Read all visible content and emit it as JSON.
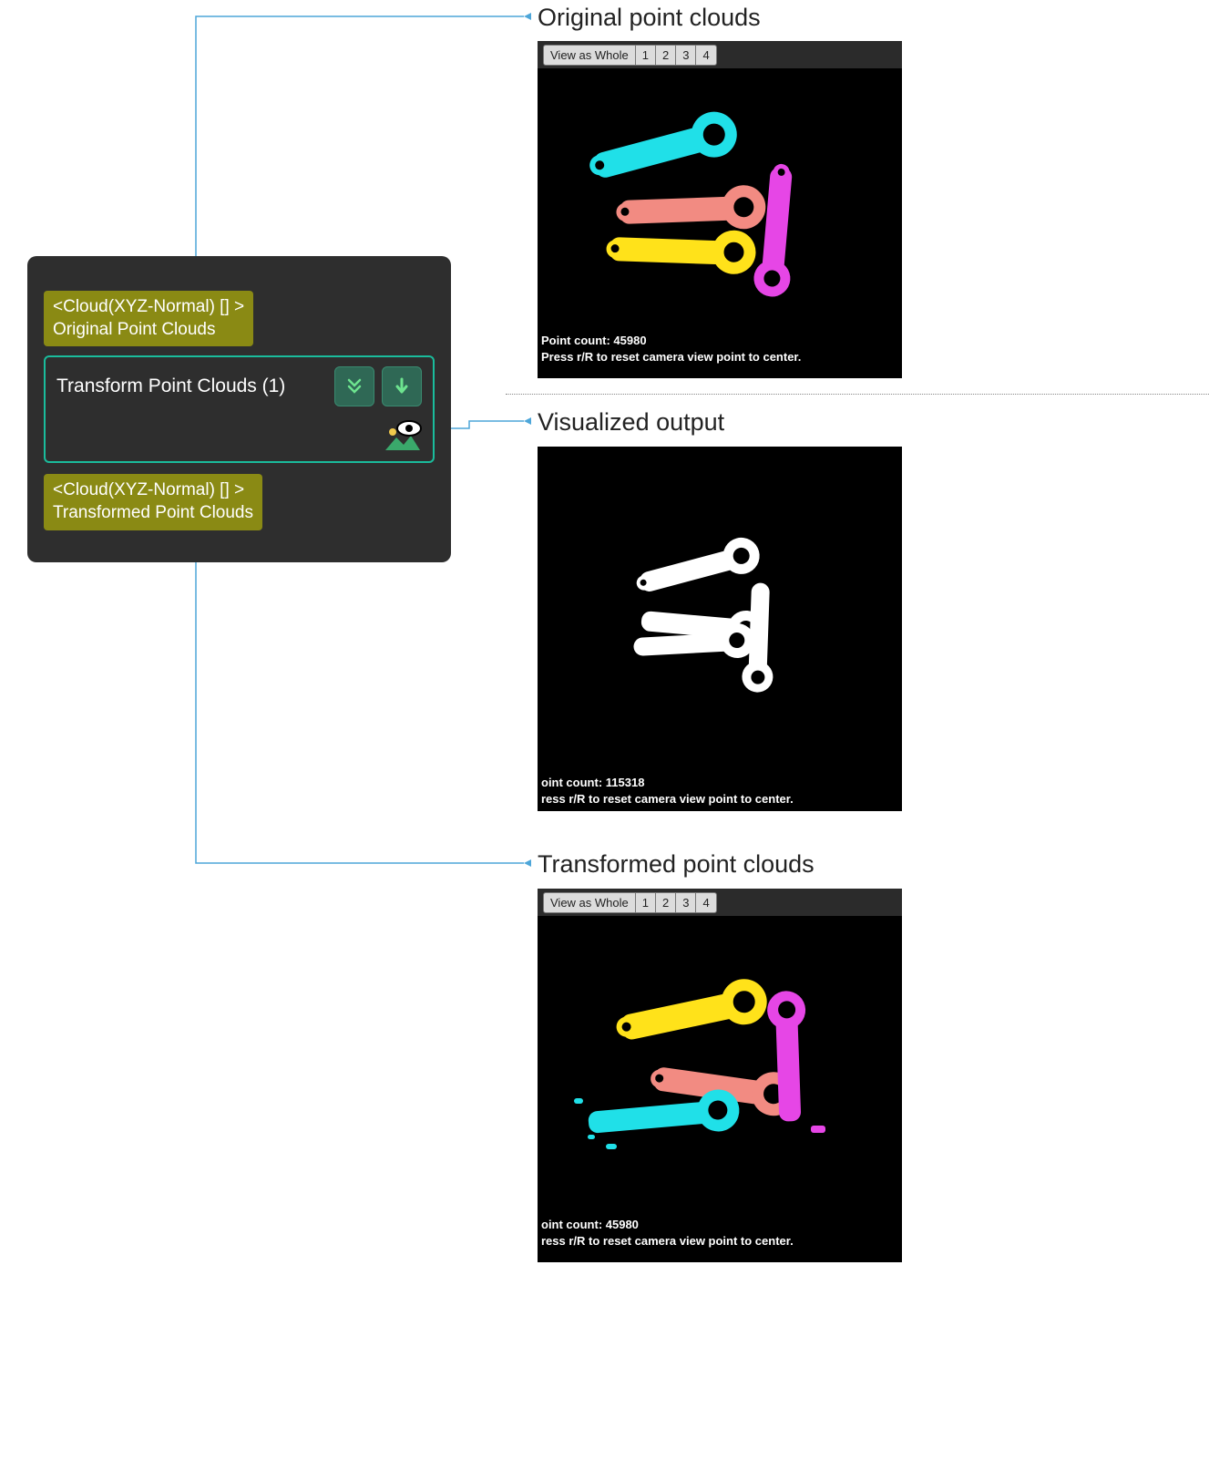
{
  "node": {
    "input_port_type": "<Cloud(XYZ-Normal) [] >",
    "input_port_label": "Original Point Clouds",
    "step_title": "Transform Point Clouds (1)",
    "output_port_type": "<Cloud(XYZ-Normal) [] >",
    "output_port_label": "Transformed Point Clouds"
  },
  "labels": {
    "original": "Original point clouds",
    "visualized": "Visualized output",
    "transformed": "Transformed point clouds"
  },
  "viewers": {
    "original": {
      "view_as_whole": "View as Whole",
      "tabs": [
        "1",
        "2",
        "3",
        "4"
      ],
      "point_count_label": "Point count: 45980",
      "reset_hint": "Press r/R to reset camera view point to center."
    },
    "visualized": {
      "point_count_label": "oint count: 115318",
      "reset_hint": "ress r/R to reset camera view point to center."
    },
    "transformed": {
      "view_as_whole": "View as Whole",
      "tabs": [
        "1",
        "2",
        "3",
        "4"
      ],
      "point_count_label": "oint count: 45980",
      "reset_hint": "ress r/R to reset camera view point to center."
    }
  },
  "colors": {
    "cyan": "#20e0e8",
    "coral": "#f28b82",
    "yellow": "#ffe21a",
    "magenta": "#e646e6",
    "white": "#ffffff"
  }
}
